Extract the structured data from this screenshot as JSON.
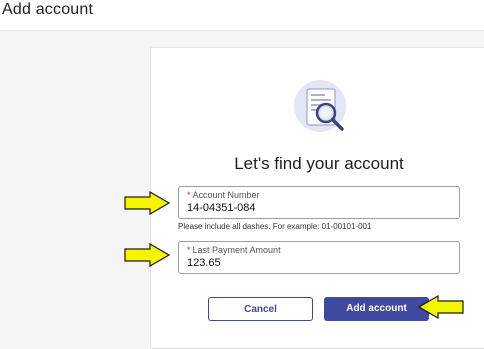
{
  "page": {
    "title": "Add account"
  },
  "card": {
    "heading": "Let's find your account",
    "account_number": {
      "required_mark": "*",
      "label": "Account Number",
      "value": "14-04351-084",
      "hint": "Please include all dashes. For example: 01-00101-001"
    },
    "last_payment": {
      "required_mark": "*",
      "label": "Last Payment Amount",
      "value": "123.65"
    },
    "buttons": {
      "cancel_label": "Cancel",
      "add_label": "Add account"
    }
  },
  "colors": {
    "accent": "#3f49a0",
    "required": "#d32f2f",
    "annotation_arrow": "#f5f500"
  },
  "icons": [
    "document-magnifier-illustration",
    "pointer-arrow-icon"
  ]
}
